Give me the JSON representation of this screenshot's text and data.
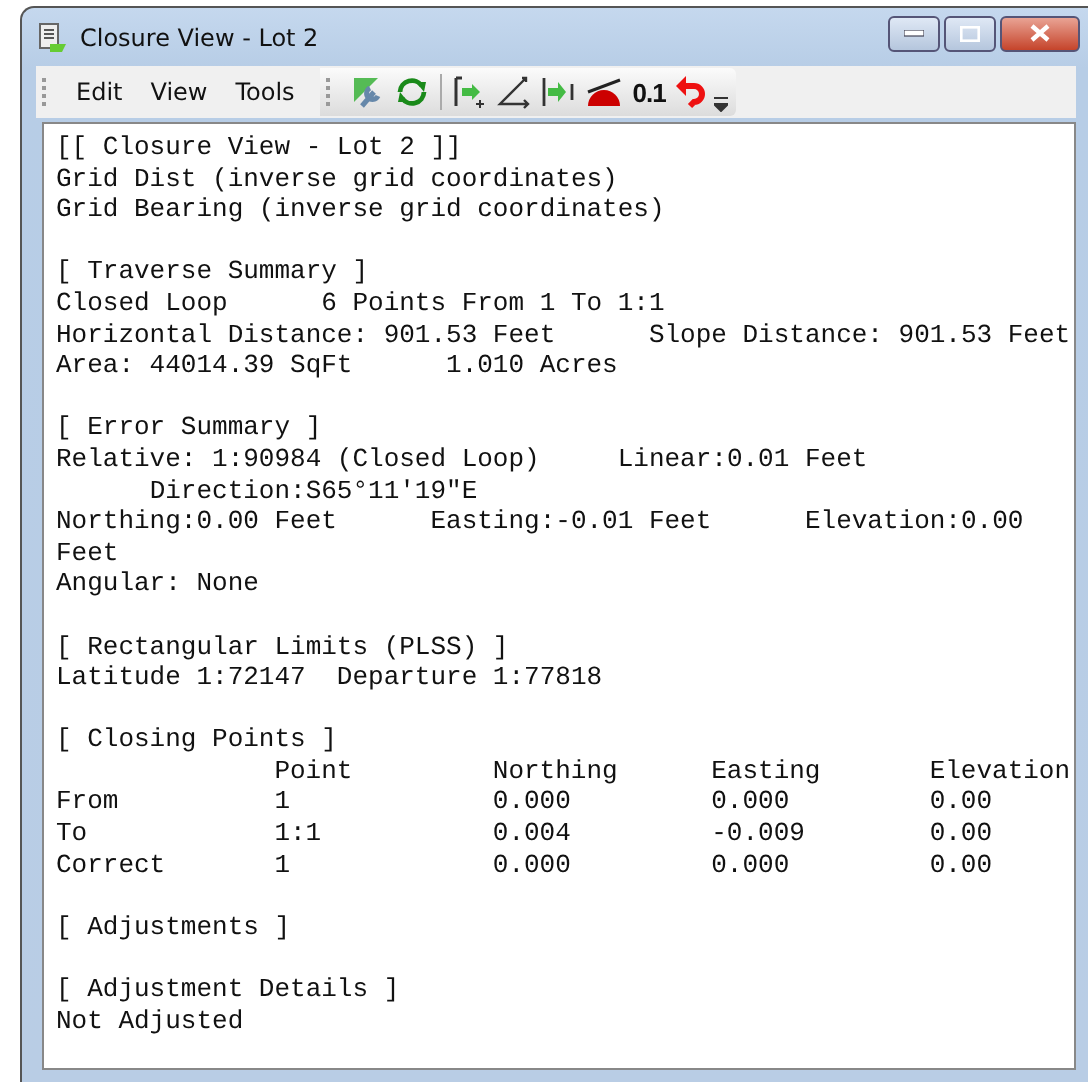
{
  "window": {
    "title": "Closure View - Lot 2"
  },
  "menu": [
    "Edit",
    "View",
    "Tools"
  ],
  "toolbar": {
    "precision_label": "0.1"
  },
  "report": [
    {
      "lines": [
        "[[ Closure View - Lot 2 ]]",
        "Grid Dist (inverse grid coordinates)",
        "Grid Bearing (inverse grid coordinates)"
      ]
    },
    {
      "lines": [
        "[ Traverse Summary ]",
        "Closed Loop      6 Points From 1 To 1:1",
        "Horizontal Distance: 901.53 Feet      Slope Distance: 901.53 Feet",
        "Area: 44014.39 SqFt      1.010 Acres"
      ]
    },
    {
      "lines": [
        "[ Error Summary ]",
        "Relative: 1:90984 (Closed Loop)     Linear:0.01 Feet",
        "      Direction:S65°11'19\"E",
        "Northing:0.00 Feet      Easting:-0.01 Feet      Elevation:0.00 Feet",
        "Angular: None"
      ]
    },
    {
      "lines": [
        "[ Rectangular Limits (PLSS) ]",
        "Latitude 1:72147  Departure 1:77818"
      ]
    },
    {
      "lines": [
        "[ Closing Points ]"
      ],
      "table": {
        "columns": [
          "",
          "Point",
          "Northing",
          "Easting",
          "Elevation"
        ],
        "rows": [
          [
            "From",
            "1",
            "0.000",
            "0.000",
            "0.00"
          ],
          [
            "To",
            "1:1",
            "0.004",
            "-0.009",
            "0.00"
          ],
          [
            "Correct",
            "1",
            "0.000",
            "0.000",
            "0.00"
          ]
        ]
      }
    },
    {
      "lines": [
        "[ Adjustments ]"
      ]
    },
    {
      "lines": [
        "[ Adjustment Details ]",
        "Not Adjusted"
      ]
    }
  ]
}
